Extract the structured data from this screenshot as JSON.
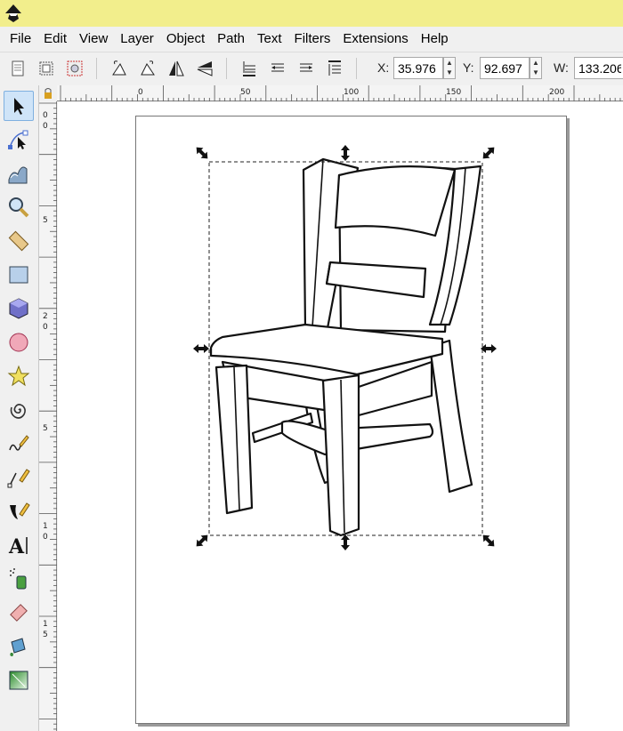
{
  "menu": {
    "items": [
      "File",
      "Edit",
      "View",
      "Layer",
      "Object",
      "Path",
      "Text",
      "Filters",
      "Extensions",
      "Help"
    ]
  },
  "toolbar": {
    "x_label": "X:",
    "x_value": "35.976",
    "y_label": "Y:",
    "y_value": "92.697",
    "w_label": "W:",
    "w_value": "133.206"
  },
  "ruler": {
    "h_labels": [
      "0",
      "50",
      "100",
      "150",
      "200"
    ],
    "v_labels": [
      "0",
      "0",
      "5",
      "2",
      "0",
      "5",
      "1",
      "0",
      "1",
      "5"
    ]
  },
  "tools": [
    "selector-tool",
    "node-tool",
    "tweak-tool",
    "zoom-tool",
    "measure-tool",
    "rectangle-tool",
    "3d-box-tool",
    "ellipse-tool",
    "star-tool",
    "spiral-tool",
    "pencil-tool",
    "pen-tool",
    "calligraphy-tool",
    "text-tool",
    "spray-tool",
    "eraser-tool",
    "paint-bucket-tool",
    "gradient-tool"
  ],
  "colors": {
    "titlebar": "#f2ee8c",
    "selected_tool": "#cfe4f8"
  }
}
